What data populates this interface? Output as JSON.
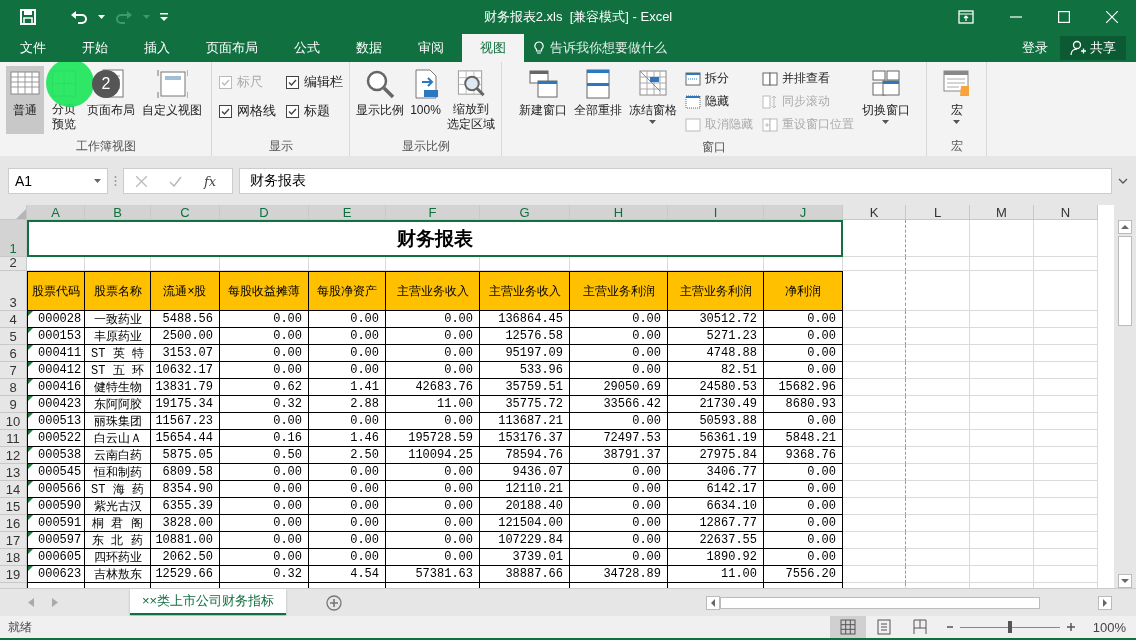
{
  "title_bar": {
    "title": "财务报表2.xls  [兼容模式] - Excel"
  },
  "menu_tabs": [
    {
      "label": "文件",
      "selected": false
    },
    {
      "label": "开始",
      "selected": false
    },
    {
      "label": "插入",
      "selected": false
    },
    {
      "label": "页面布局",
      "selected": false
    },
    {
      "label": "公式",
      "selected": false
    },
    {
      "label": "数据",
      "selected": false
    },
    {
      "label": "审阅",
      "selected": false
    },
    {
      "label": "视图",
      "selected": true
    }
  ],
  "tell_me": {
    "placeholder": "告诉我你想要做什么"
  },
  "account": {
    "sign_in": "登录",
    "share": "共享"
  },
  "ribbon_groups": [
    {
      "label": "工作簿视图",
      "items": [
        {
          "kind": "large",
          "label_lines": [
            "普通"
          ],
          "selected": true
        },
        {
          "kind": "large",
          "label_lines": [
            "分页",
            "预览"
          ],
          "selected": false
        },
        {
          "kind": "large",
          "label_lines": [
            "页面布局"
          ],
          "selected": false
        },
        {
          "kind": "large",
          "label_lines": [
            "自定义视图"
          ],
          "selected": false
        }
      ]
    },
    {
      "label": "显示",
      "items": [
        {
          "kind": "check",
          "label": "标尺",
          "checked": true,
          "disabled": true
        },
        {
          "kind": "check",
          "label": "编辑栏",
          "checked": true,
          "disabled": false
        },
        {
          "kind": "check",
          "label": "网格线",
          "checked": true,
          "disabled": false
        },
        {
          "kind": "check",
          "label": "标题",
          "checked": true,
          "disabled": false
        }
      ]
    },
    {
      "label": "显示比例",
      "items": [
        {
          "kind": "large",
          "label_lines": [
            "显示比例"
          ],
          "selected": false
        },
        {
          "kind": "large",
          "label_lines": [
            "100%"
          ],
          "selected": false
        },
        {
          "kind": "large",
          "label_lines": [
            "缩放到",
            "选定区域"
          ],
          "selected": false
        }
      ]
    },
    {
      "label": "窗口",
      "items": [
        {
          "kind": "large",
          "label_lines": [
            "新建窗口"
          ],
          "selected": false
        },
        {
          "kind": "large",
          "label_lines": [
            "全部重排"
          ],
          "selected": false
        },
        {
          "kind": "large",
          "label_lines": [
            "冻结窗格"
          ],
          "selected": false,
          "dropdown": true
        },
        {
          "kind": "small",
          "label": "拆分",
          "disabled": false
        },
        {
          "kind": "small",
          "label": "隐藏",
          "disabled": false
        },
        {
          "kind": "small",
          "label": "取消隐藏",
          "disabled": true
        },
        {
          "kind": "small",
          "label": "并排查看",
          "disabled": false
        },
        {
          "kind": "small",
          "label": "同步滚动",
          "disabled": true
        },
        {
          "kind": "small",
          "label": "重设窗口位置",
          "disabled": true
        },
        {
          "kind": "large",
          "label_lines": [
            "切换窗口"
          ],
          "selected": false,
          "dropdown": true
        }
      ]
    },
    {
      "label": "宏",
      "items": [
        {
          "kind": "large",
          "label_lines": [
            "宏"
          ],
          "selected": false,
          "dropdown": true
        }
      ]
    }
  ],
  "tutorial_overlay": {
    "step": "2"
  },
  "formula_bar": {
    "name_box": "A1",
    "function_label": "fx",
    "formula": "财务报表"
  },
  "sheet": {
    "columns": [
      {
        "label": "A",
        "selected": true,
        "page_break": false
      },
      {
        "label": "B",
        "selected": true,
        "page_break": false
      },
      {
        "label": "C",
        "selected": true,
        "page_break": false
      },
      {
        "label": "D",
        "selected": true,
        "page_break": false
      },
      {
        "label": "E",
        "selected": true,
        "page_break": false
      },
      {
        "label": "F",
        "selected": true,
        "page_break": false
      },
      {
        "label": "G",
        "selected": true,
        "page_break": false
      },
      {
        "label": "H",
        "selected": true,
        "page_break": false
      },
      {
        "label": "I",
        "selected": true,
        "page_break": false
      },
      {
        "label": "J",
        "selected": true,
        "page_break": false
      },
      {
        "label": "K",
        "selected": false,
        "page_break": true
      },
      {
        "label": "L",
        "selected": false,
        "page_break": false
      },
      {
        "label": "M",
        "selected": false,
        "page_break": false
      },
      {
        "label": "N",
        "selected": false,
        "page_break": false
      }
    ],
    "row_headers": [
      {
        "label": "1",
        "selected": true
      },
      {
        "label": "2",
        "selected": false
      },
      {
        "label": "3",
        "selected": false
      }
    ],
    "title": "财务报表",
    "header_row": [
      "股票代码",
      "股票名称",
      "流通×股",
      "每股收益摊薄",
      "每股净资产",
      "主营业务收入",
      "主营业务收入",
      "主营业务利润",
      "主营业务利润",
      "净利润"
    ],
    "rows": [
      {
        "number": "4",
        "flag": true,
        "cells": [
          "000028",
          "一致药业",
          "5488.56",
          "0.00",
          "0.00",
          "0.00",
          "136864.45",
          "0.00",
          "30512.72",
          "0.00"
        ]
      },
      {
        "number": "5",
        "flag": true,
        "cells": [
          "000153",
          "丰原药业",
          "2500.00",
          "0.00",
          "0.00",
          "0.00",
          "12576.58",
          "0.00",
          "5271.23",
          "0.00"
        ]
      },
      {
        "number": "6",
        "flag": true,
        "cells": [
          "000411",
          "ST 英 特",
          "3153.07",
          "0.00",
          "0.00",
          "0.00",
          "95197.09",
          "0.00",
          "4748.88",
          "0.00"
        ]
      },
      {
        "number": "7",
        "flag": true,
        "cells": [
          "000412",
          "ST 五 环",
          "10632.17",
          "0.00",
          "0.00",
          "0.00",
          "533.96",
          "0.00",
          "82.51",
          "0.00"
        ]
      },
      {
        "number": "8",
        "flag": true,
        "cells": [
          "000416",
          "健特生物",
          "13831.79",
          "0.62",
          "1.41",
          "42683.76",
          "35759.51",
          "29050.69",
          "24580.53",
          "15682.96"
        ]
      },
      {
        "number": "9",
        "flag": true,
        "cells": [
          "000423",
          "东阿阿胶",
          "19175.34",
          "0.32",
          "2.88",
          "11.00",
          "35775.72",
          "33566.42",
          "21730.49",
          "8680.93"
        ]
      },
      {
        "number": "10",
        "flag": true,
        "cells": [
          "000513",
          "丽珠集团",
          "11567.23",
          "0.00",
          "0.00",
          "0.00",
          "113687.21",
          "0.00",
          "50593.88",
          "0.00"
        ]
      },
      {
        "number": "11",
        "flag": true,
        "cells": [
          "000522",
          "白云山Ａ",
          "15654.44",
          "0.16",
          "1.46",
          "195728.59",
          "153176.37",
          "72497.53",
          "56361.19",
          "5848.21"
        ]
      },
      {
        "number": "12",
        "flag": true,
        "cells": [
          "000538",
          "云南白药",
          "5875.05",
          "0.50",
          "2.50",
          "110094.25",
          "78594.76",
          "38791.37",
          "27975.84",
          "9368.76"
        ]
      },
      {
        "number": "13",
        "flag": true,
        "cells": [
          "000545",
          "恒和制药",
          "6809.58",
          "0.00",
          "0.00",
          "0.00",
          "9436.07",
          "0.00",
          "3406.77",
          "0.00"
        ]
      },
      {
        "number": "14",
        "flag": true,
        "cells": [
          "000566",
          "ST 海 药",
          "8354.90",
          "0.00",
          "0.00",
          "0.00",
          "12110.21",
          "0.00",
          "6142.17",
          "0.00"
        ]
      },
      {
        "number": "15",
        "flag": true,
        "cells": [
          "000590",
          "紫光古汉",
          "6355.39",
          "0.00",
          "0.00",
          "0.00",
          "20188.40",
          "0.00",
          "6634.10",
          "0.00"
        ]
      },
      {
        "number": "16",
        "flag": true,
        "cells": [
          "000591",
          "桐 君 阁",
          "3828.00",
          "0.00",
          "0.00",
          "0.00",
          "121504.00",
          "0.00",
          "12867.77",
          "0.00"
        ]
      },
      {
        "number": "17",
        "flag": true,
        "cells": [
          "000597",
          "东 北 药",
          "10881.00",
          "0.00",
          "0.00",
          "0.00",
          "107229.84",
          "0.00",
          "22637.55",
          "0.00"
        ]
      },
      {
        "number": "18",
        "flag": true,
        "cells": [
          "000605",
          "四环药业",
          "2062.50",
          "0.00",
          "0.00",
          "0.00",
          "3739.01",
          "0.00",
          "1890.92",
          "0.00"
        ]
      },
      {
        "number": "19",
        "flag": true,
        "cells": [
          "000623",
          "吉林敖东",
          "12529.66",
          "0.32",
          "4.54",
          "57381.63",
          "38887.66",
          "34728.89",
          "11.00",
          "7556.20"
        ]
      }
    ]
  },
  "sheet_tabs": [
    {
      "label": "××类上市公司财务指标",
      "selected": true
    }
  ],
  "status_bar": {
    "status": "就绪",
    "views": [
      {
        "selected": true
      },
      {
        "selected": false
      },
      {
        "selected": false
      }
    ],
    "zoom": {
      "level": 0.5,
      "reading": "100%"
    }
  }
}
